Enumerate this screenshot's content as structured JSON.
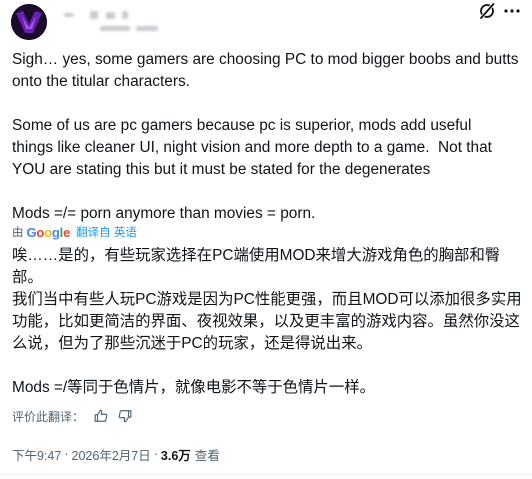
{
  "tweet": {
    "en_paragraphs": [
      "Sigh… yes, some gamers are choosing PC to mod bigger boobs and butts\nonto the titular characters.",
      "Some of us are pc gamers because pc is superior, mods add useful\nthings like cleaner UI, night vision and more depth to a game.  Not that\nYOU are stating this but it must be stated for the degenerates",
      "Mods =/= porn anymore than movies = porn."
    ],
    "translation_label": {
      "by": "由",
      "provider": "Google",
      "action": "翻译自 英语"
    },
    "zh_paragraphs": [
      "唉……是的，有些玩家选择在PC端使用MOD来增大游戏角色的胸部和臀部。",
      "我们当中有些人玩PC游戏是因为PC性能更强，而且MOD可以添加很多实用\n功能，比如更简洁的界面、夜视效果，以及更丰富的游戏内容。虽然你没这\n么说，但为了那些沉迷于PC的玩家，还是得说出来。",
      "Mods =/等同于色情片，就像电影不等于色情片一样。"
    ],
    "rate_translation": "评价此翻译：",
    "time": "下午9:47",
    "date": "2026年2月7日",
    "separator": "·",
    "views": "3.6万",
    "views_label": "查看"
  },
  "icons": {
    "grok": "grok-icon",
    "more": "more-icon",
    "thumbs_up": "thumbs-up-icon",
    "thumbs_down": "thumbs-down-icon"
  },
  "colors": {
    "text": "#0f1419",
    "secondary": "#536471",
    "link": "#1d9bf0",
    "avatar_bg": "#1a0b2b",
    "avatar_accent": "#6a1fb3"
  }
}
